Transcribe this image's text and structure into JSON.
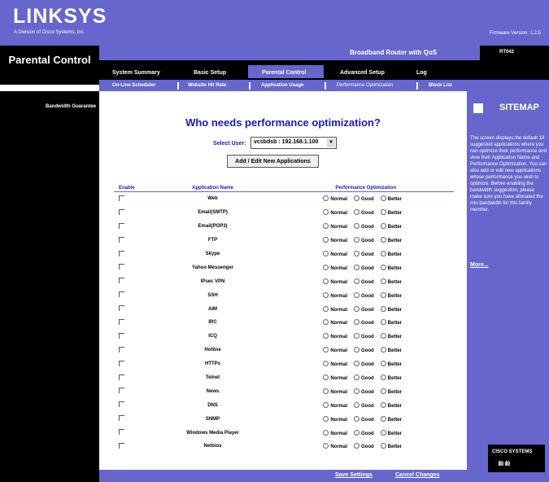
{
  "brand": {
    "logo": "LINKSYS",
    "tagline": "A Division of Cisco Systems, Inc.",
    "firmware": "Firmware Version: 1.2.5"
  },
  "header": {
    "section_title": "Parental Control",
    "product_name": "Broadband Router with QoS",
    "model": "RT042"
  },
  "tabs": [
    {
      "label": "System Summary"
    },
    {
      "label": "Basic Setup"
    },
    {
      "label": "Parental Control"
    },
    {
      "label": "Advanced Setup"
    },
    {
      "label": "Log"
    }
  ],
  "subtabs": [
    {
      "label": "On-Line Scheduler"
    },
    {
      "label": "Website Hit Rate"
    },
    {
      "label": "Application Usage"
    },
    {
      "label": "Performance Optimization"
    },
    {
      "label": "Block List"
    }
  ],
  "left_nav": {
    "item": "Bandwidth Guarantee"
  },
  "main": {
    "heading": "Who needs performance optimization?",
    "select_user_label": "Select User:",
    "select_user_value": "vcsbdsb : 192.168.1.100",
    "add_button": "Add / Edit New Applications",
    "columns": {
      "enable": "Enable",
      "app_name": "Application Name",
      "perf": "Performance Optimization"
    },
    "options": {
      "normal": "Normal",
      "good": "Good",
      "better": "Better"
    },
    "apps": [
      "Web",
      "Email(SMTP)",
      "Email(POP3)",
      "FTP",
      "Skype",
      "Yahoo Messenger",
      "IPsec VPN",
      "SSH",
      "AIM",
      "IRC",
      "ICQ",
      "Hotline",
      "HTTPs",
      "Telnet",
      "News",
      "DNS",
      "SNMP",
      "Windows Media Player",
      "Netbios"
    ]
  },
  "sitemap": {
    "title": "SITEMAP",
    "help": "The screen displays the default 19 suggested applications where you can optimize their performance and view their Application Name and Performance Optimization. You can also add or edit new applications whose performance you wish to optimize. Before enabling the bandwidth suggestion, please make sure you have allocated the min bandwidth for this family member.",
    "more": "More..."
  },
  "footer": {
    "save": "Save Settings",
    "cancel": "Cancel Changes",
    "cisco": "CISCO SYSTEMS",
    "cisco_bars": "ılılı ılılı"
  }
}
